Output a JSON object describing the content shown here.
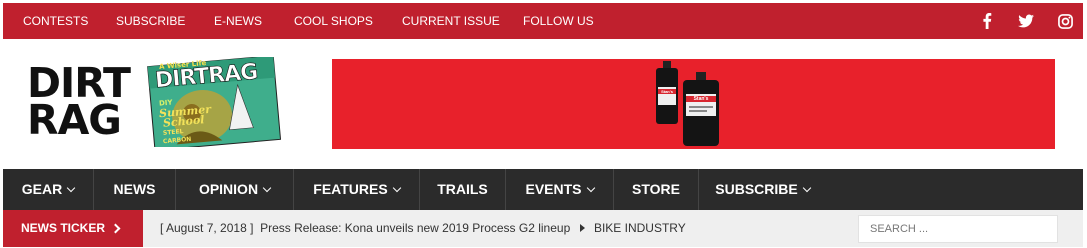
{
  "topbar": {
    "links": [
      "CONTESTS",
      "SUBSCRIBE",
      "E-NEWS",
      "COOL SHOPS",
      "CURRENT ISSUE",
      "FOLLOW US"
    ],
    "social_icons": [
      "facebook-icon",
      "twitter-icon",
      "instagram-icon"
    ]
  },
  "header": {
    "logo_line1": "DIRT",
    "logo_line2": "RAG",
    "magazine": {
      "masthead": "DIRTRAG",
      "tagline": "A Wiser Life",
      "cover_line1": "DIY",
      "cover_line2": "Summer",
      "cover_line3": "School",
      "cover_line4": "STEEL",
      "cover_line5": "CARBON"
    },
    "ad": {
      "bottle1": "Stan's",
      "bottle2": "Stan's"
    }
  },
  "nav": {
    "items": [
      {
        "label": "GEAR",
        "dropdown": true
      },
      {
        "label": "NEWS",
        "dropdown": false
      },
      {
        "label": "OPINION",
        "dropdown": true
      },
      {
        "label": "FEATURES",
        "dropdown": true
      },
      {
        "label": "TRAILS",
        "dropdown": false
      },
      {
        "label": "EVENTS",
        "dropdown": true
      },
      {
        "label": "STORE",
        "dropdown": false
      },
      {
        "label": "SUBSCRIBE",
        "dropdown": true
      }
    ]
  },
  "ticker": {
    "label": "NEWS TICKER",
    "date": "[ August 7, 2018 ]",
    "headline": "Press Release: Kona unveils new 2019 Process G2 lineup",
    "category": "BIKE INDUSTRY"
  },
  "search": {
    "placeholder": "SEARCH ..."
  },
  "colors": {
    "brand_red": "#c0202e",
    "nav_bg": "#2b2b2b",
    "ad_red": "#e8212b"
  }
}
